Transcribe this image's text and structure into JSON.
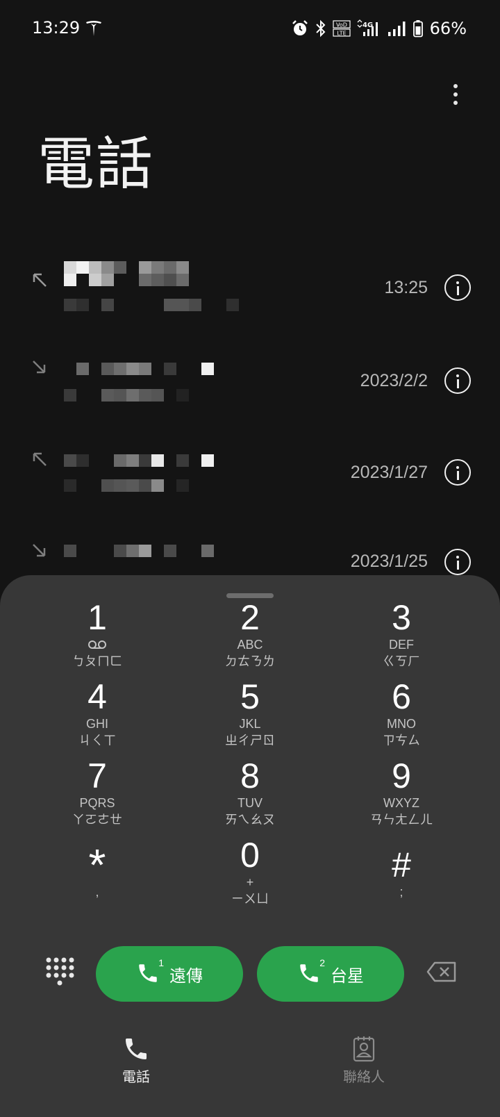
{
  "status_bar": {
    "time": "13:29",
    "battery_percent": "66%",
    "icons": [
      "tesla-icon",
      "alarm-icon",
      "bluetooth-icon",
      "volte-icon",
      "4g-signal-icon",
      "signal-icon",
      "battery-icon"
    ]
  },
  "header": {
    "title": "電話",
    "more_icon": "more-vert-icon"
  },
  "call_log": [
    {
      "direction": "outgoing",
      "time": "13:25"
    },
    {
      "direction": "incoming",
      "time": "2023/2/2"
    },
    {
      "direction": "outgoing",
      "time": "2023/1/27"
    },
    {
      "direction": "incoming",
      "time": "2023/1/25"
    }
  ],
  "dialpad": {
    "keys": [
      {
        "digit": "1",
        "letters": "",
        "zhuyin": "ㄅㄆㄇㄈ",
        "voicemail": true
      },
      {
        "digit": "2",
        "letters": "ABC",
        "zhuyin": "ㄉㄊㄋㄌ"
      },
      {
        "digit": "3",
        "letters": "DEF",
        "zhuyin": "ㄍㄎㄏ"
      },
      {
        "digit": "4",
        "letters": "GHI",
        "zhuyin": "ㄐㄑㄒ"
      },
      {
        "digit": "5",
        "letters": "JKL",
        "zhuyin": "ㄓㄔㄕㄖ"
      },
      {
        "digit": "6",
        "letters": "MNO",
        "zhuyin": "ㄗㄘㄙ"
      },
      {
        "digit": "7",
        "letters": "PQRS",
        "zhuyin": "ㄚㄛㄜㄝ"
      },
      {
        "digit": "8",
        "letters": "TUV",
        "zhuyin": "ㄞㄟㄠㄡ"
      },
      {
        "digit": "9",
        "letters": "WXYZ",
        "zhuyin": "ㄢㄣㄤㄥㄦ"
      },
      {
        "digit": "*",
        "letters": ",",
        "zhuyin": ""
      },
      {
        "digit": "0",
        "letters": "+",
        "zhuyin": "ㄧㄨㄩ"
      },
      {
        "digit": "#",
        "letters": ";",
        "zhuyin": ""
      }
    ],
    "call_buttons": [
      {
        "sim": "1",
        "label": "遠傳"
      },
      {
        "sim": "2",
        "label": "台星"
      }
    ],
    "accent_color": "#2aa34d"
  },
  "bottom_nav": {
    "tabs": [
      {
        "label": "電話",
        "icon": "phone-icon",
        "active": true
      },
      {
        "label": "聯絡人",
        "icon": "contacts-icon",
        "active": false
      }
    ]
  }
}
